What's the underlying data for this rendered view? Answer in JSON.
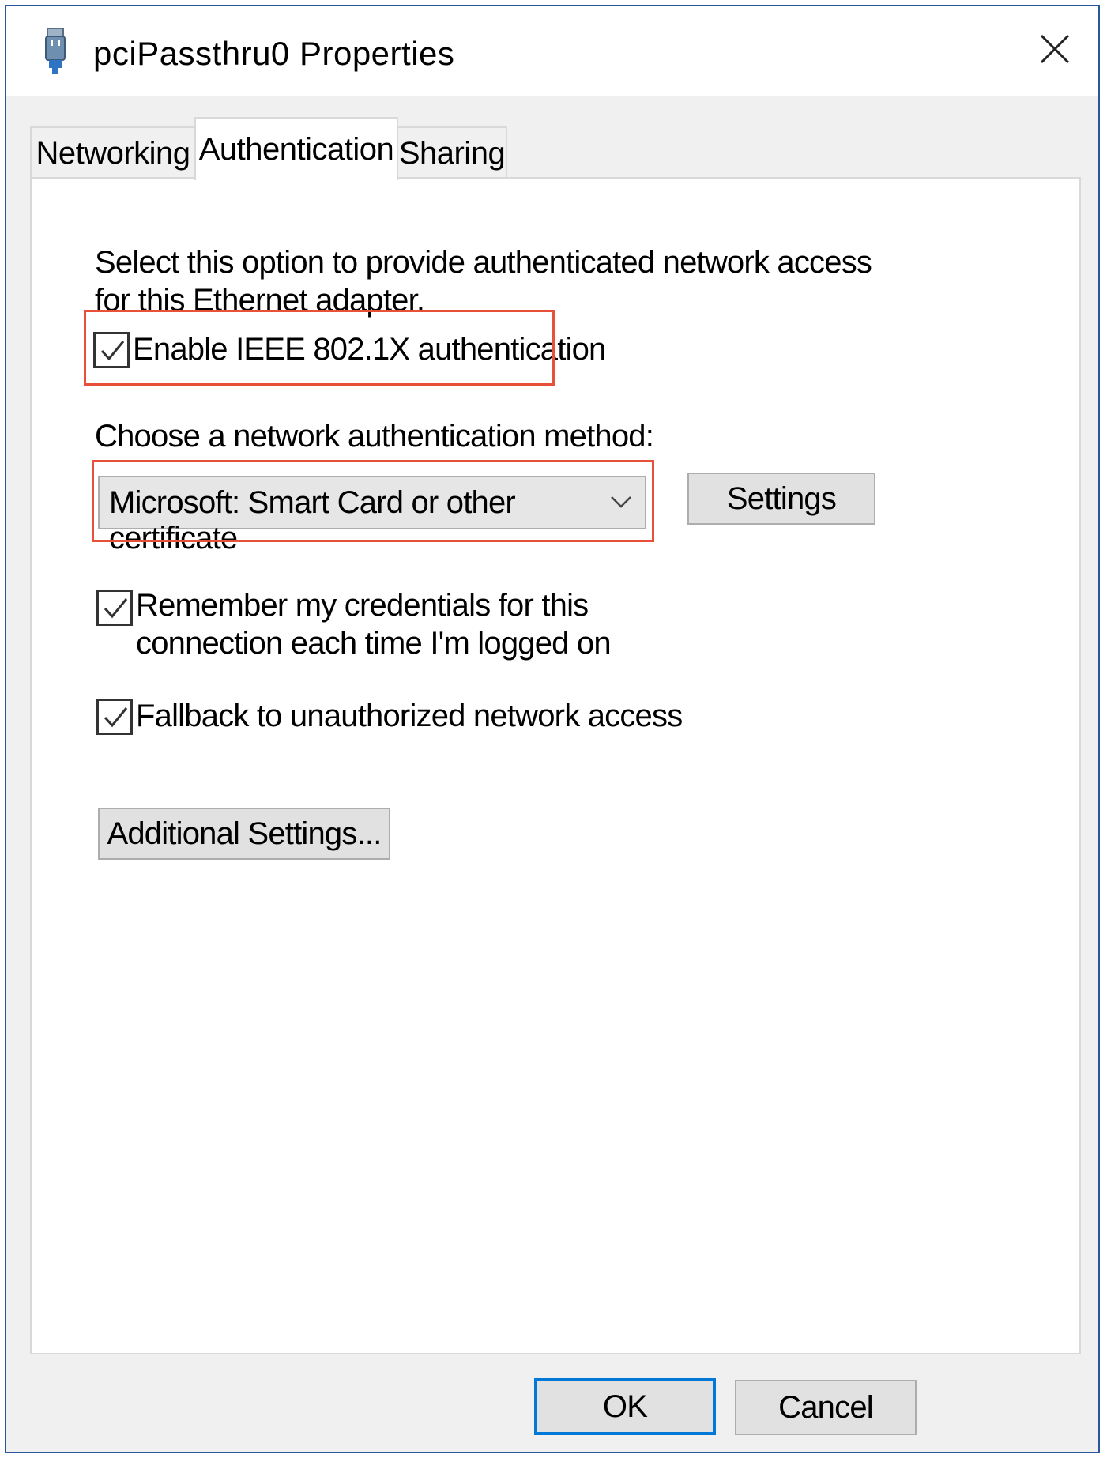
{
  "window": {
    "title": "pciPassthru0 Properties",
    "accent_color": "#0078d7",
    "highlight_color": "#e8503a"
  },
  "tabs": [
    {
      "label": "Networking",
      "active": false
    },
    {
      "label": "Authentication",
      "active": true
    },
    {
      "label": "Sharing",
      "active": false
    }
  ],
  "auth": {
    "description": "Select this option to provide authenticated network access for this Ethernet adapter.",
    "enable_8021x": {
      "label": "Enable IEEE 802.1X authentication",
      "checked": true
    },
    "method_prompt": "Choose a network authentication method:",
    "method_selected": "Microsoft: Smart Card or other certificate",
    "settings_button": "Settings",
    "remember_credentials": {
      "label": "Remember my credentials for this connection each time I'm logged on",
      "checked": true
    },
    "fallback": {
      "label": "Fallback to unauthorized network access",
      "checked": true
    },
    "additional_settings_button": "Additional Settings..."
  },
  "footer": {
    "ok_label": "OK",
    "cancel_label": "Cancel"
  },
  "icons": {
    "title": "network-adapter-icon",
    "close": "close-icon",
    "dropdown": "chevron-down-icon",
    "check": "checkmark-icon"
  }
}
